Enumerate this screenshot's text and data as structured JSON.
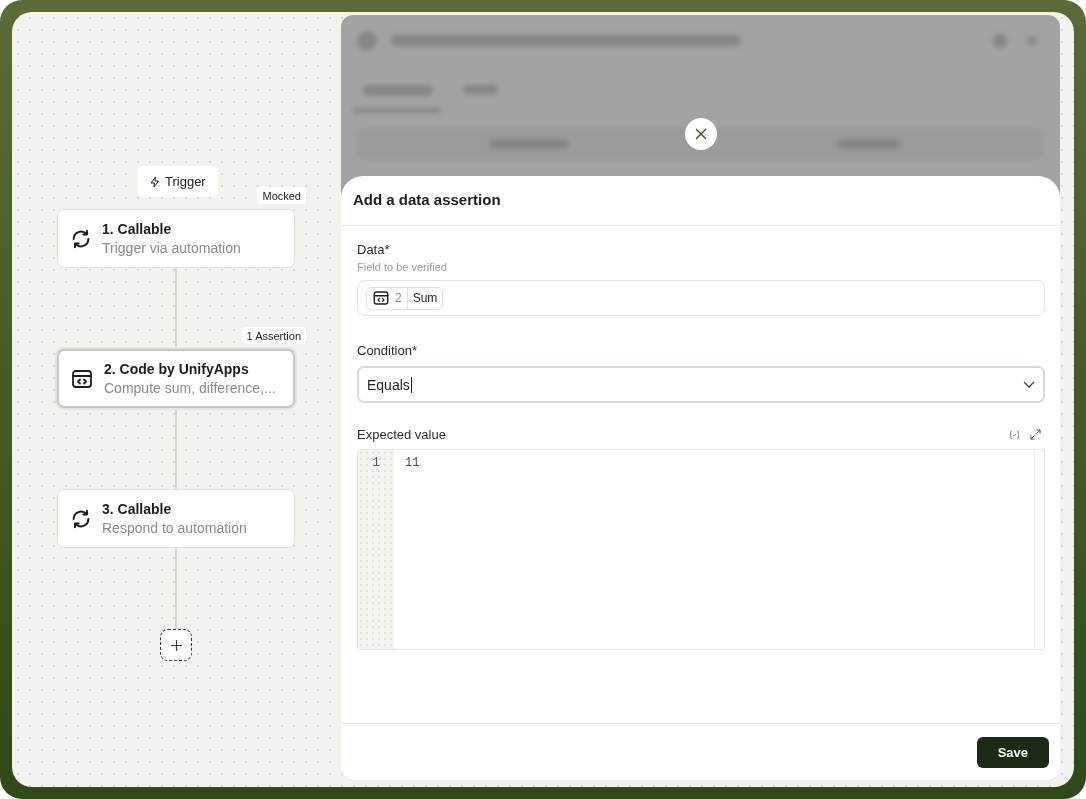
{
  "flow": {
    "trigger": {
      "label": "Trigger"
    },
    "steps": [
      {
        "kind": "callable",
        "title": "1. Callable",
        "subtitle": "Trigger via automation",
        "badge": "Mocked",
        "selected": false
      },
      {
        "kind": "code",
        "title": "2. Code by UnifyApps",
        "subtitle": "Compute sum, difference,...",
        "badge": "1 Assertion",
        "selected": true
      },
      {
        "kind": "callable",
        "title": "3. Callable",
        "subtitle": "Respond to automation",
        "selected": false
      }
    ]
  },
  "modal": {
    "title": "Add a data assertion",
    "data_field": {
      "label": "Data*",
      "hint": "Field to be verified",
      "token": {
        "step": "2",
        "field": "Sum"
      }
    },
    "condition": {
      "label": "Condition*",
      "value": "Equals"
    },
    "expected": {
      "label": "Expected value",
      "lines": [
        {
          "number": "1",
          "code": "11"
        }
      ]
    },
    "buttons": [
      "Save"
    ]
  }
}
